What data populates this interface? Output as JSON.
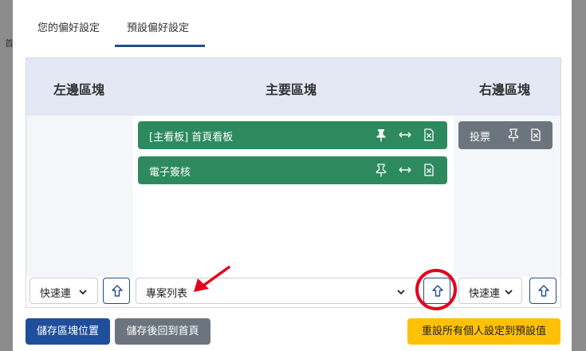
{
  "background": {
    "label": "首"
  },
  "tabs": [
    {
      "label": "您的偏好設定"
    },
    {
      "label": "預設偏好設定"
    }
  ],
  "columns": {
    "left": {
      "title": "左邊區塊"
    },
    "main": {
      "title": "主要區塊"
    },
    "right": {
      "title": "右邊區塊"
    }
  },
  "blocks": {
    "main": [
      {
        "label": "[主看板] 首頁看板",
        "pinned": true
      },
      {
        "label": "電子簽核",
        "pinned": false
      }
    ],
    "right": [
      {
        "label": "投票",
        "pinned": false
      }
    ]
  },
  "selects": {
    "left": {
      "value": "快速連"
    },
    "main": {
      "value": "專案列表"
    },
    "right": {
      "value": "快速連"
    }
  },
  "buttons": {
    "save": "儲存區塊位置",
    "save_home": "儲存後回到首頁",
    "reset": "重設所有個人設定到預設值"
  },
  "colors": {
    "primary": "#1f4e9c",
    "success": "#2d8a5f",
    "secondary": "#6c757d",
    "warning": "#ffc107",
    "annotation": "#e5001c"
  },
  "icons": {
    "pin": "pin-icon",
    "resize": "arrows-horizontal-icon",
    "delete": "delete-icon",
    "up": "arrow-up-icon",
    "chevron": "chevron-down-icon"
  }
}
